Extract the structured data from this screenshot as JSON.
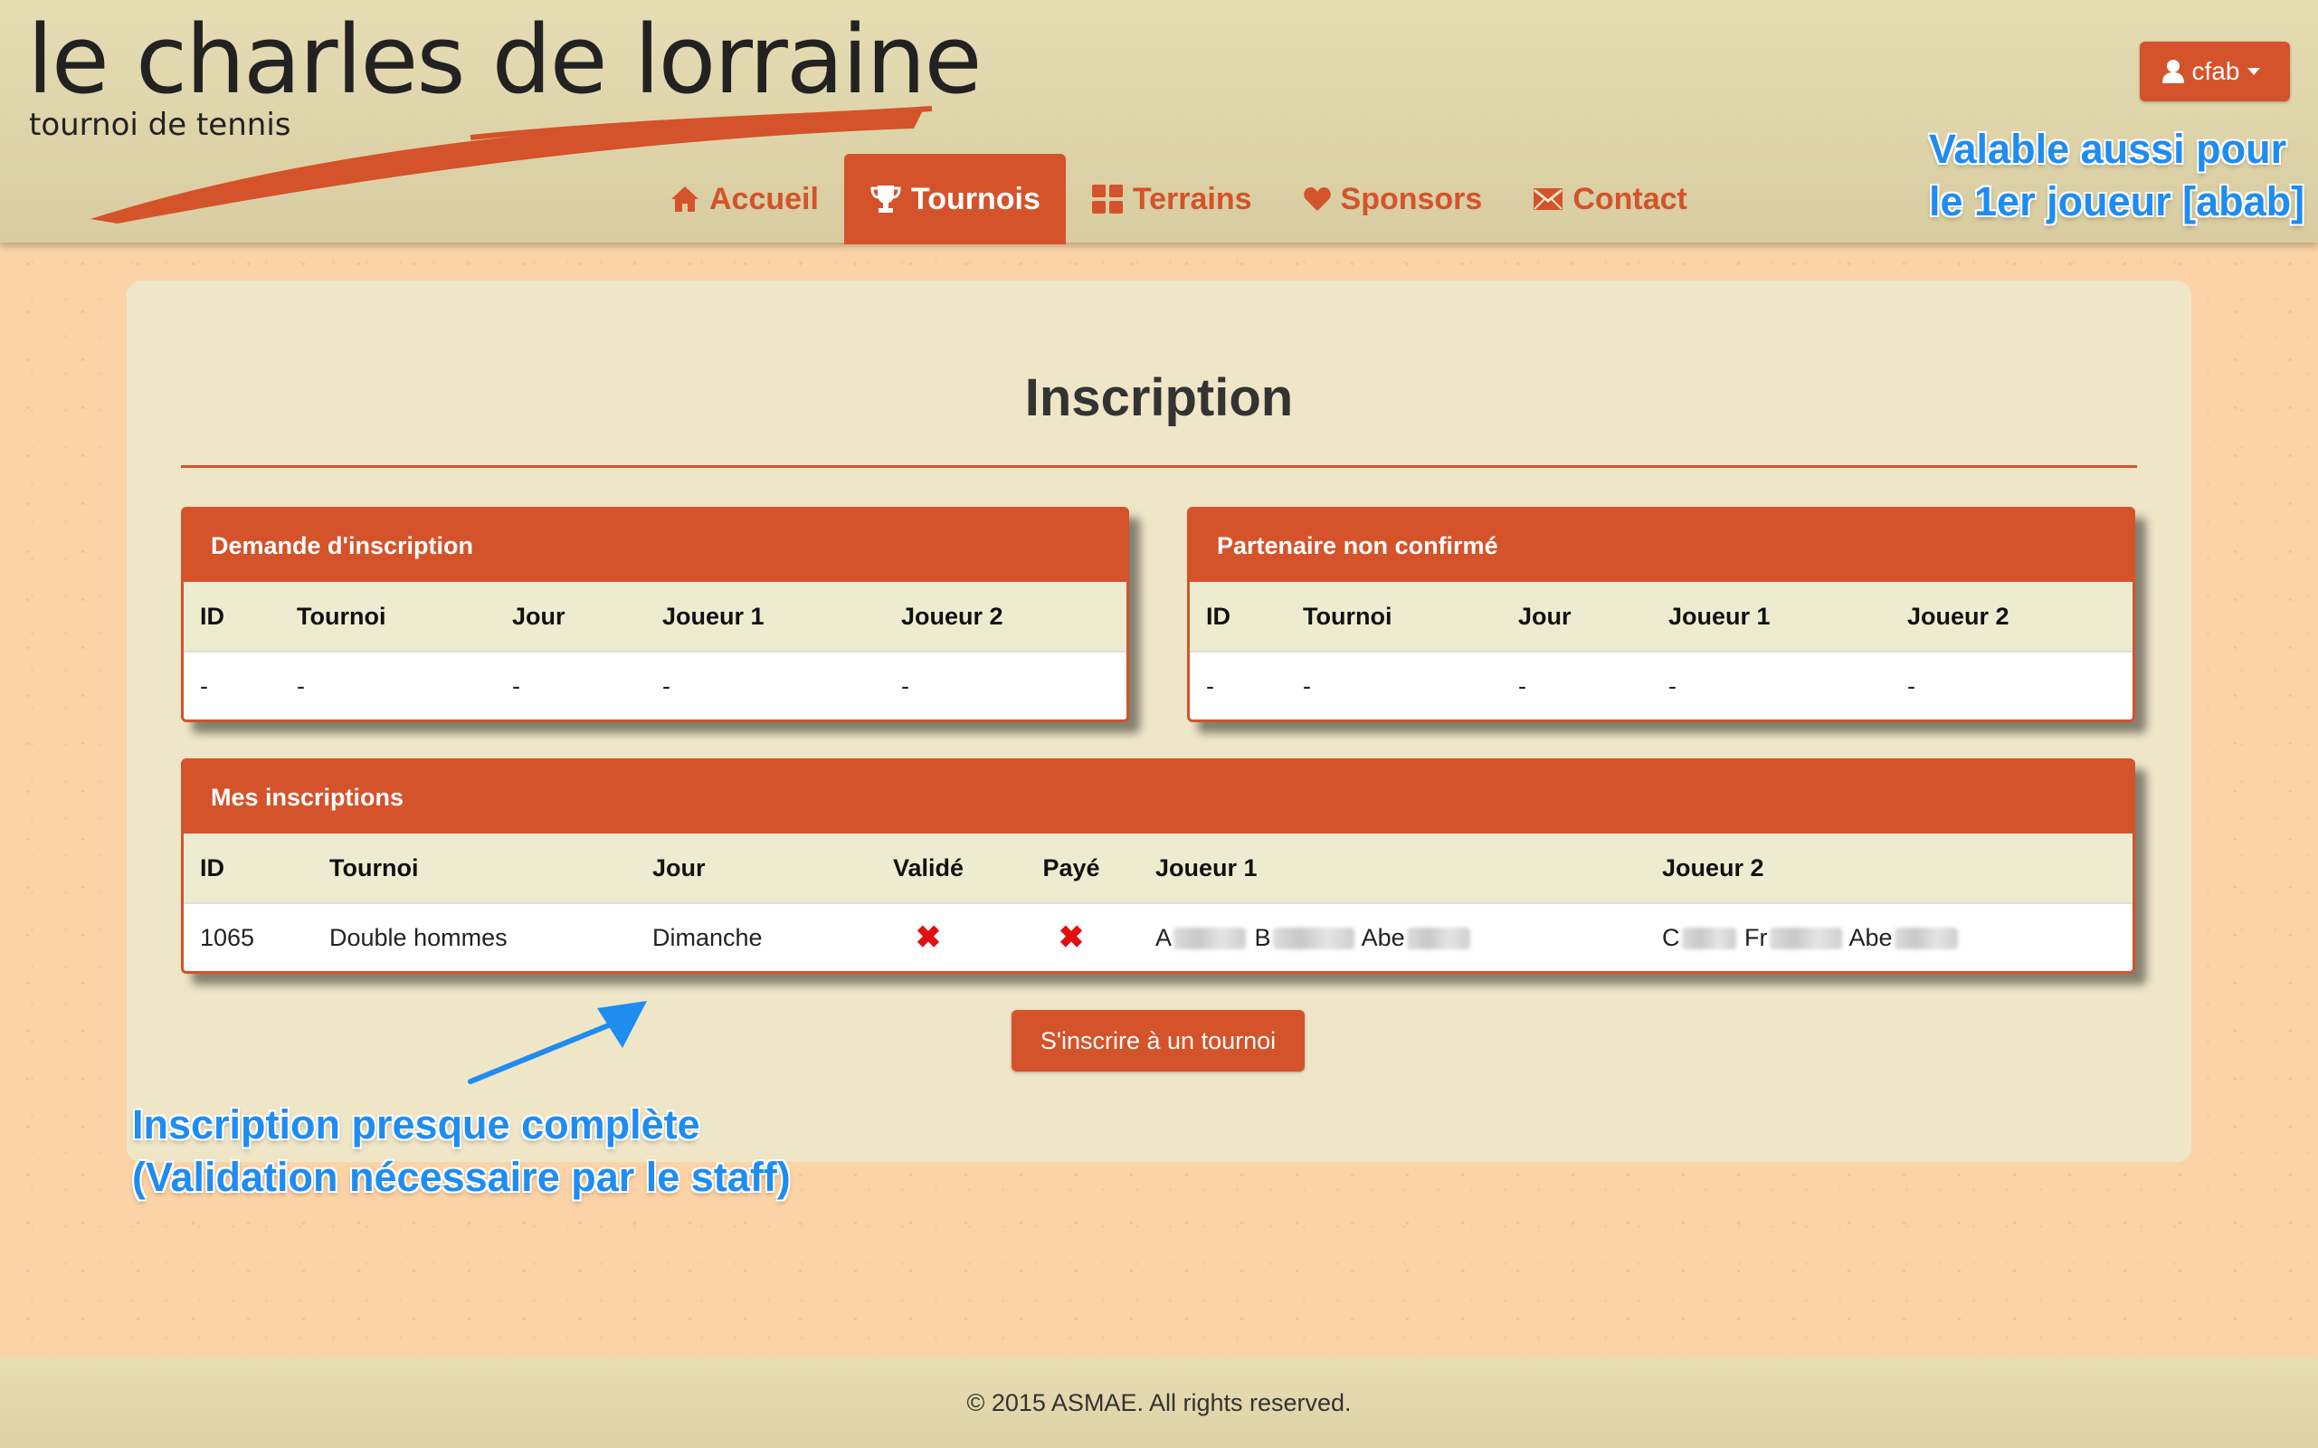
{
  "logo": {
    "title": "le charles de lorraine",
    "subtitle": "tournoi de tennis"
  },
  "nav": {
    "items": [
      {
        "label": "Accueil",
        "icon": "home-icon"
      },
      {
        "label": "Tournois",
        "icon": "trophy-icon",
        "active": true
      },
      {
        "label": "Terrains",
        "icon": "grid-icon"
      },
      {
        "label": "Sponsors",
        "icon": "heart-icon"
      },
      {
        "label": "Contact",
        "icon": "envelope-icon"
      }
    ]
  },
  "user_menu": {
    "label": "cfab",
    "icon": "user-icon"
  },
  "annotations": {
    "top_line1": "Valable aussi pour",
    "top_line2": "le 1er joueur [abab]",
    "bottom_line1": "Inscription presque complète",
    "bottom_line2": "(Validation nécessaire par le staff)"
  },
  "page": {
    "title": "Inscription"
  },
  "demande": {
    "title": "Demande d'inscription",
    "headers": [
      "ID",
      "Tournoi",
      "Jour",
      "Joueur 1",
      "Joueur 2"
    ],
    "row": [
      "-",
      "-",
      "-",
      "-",
      "-"
    ]
  },
  "partenaire": {
    "title": "Partenaire non confirmé",
    "headers": [
      "ID",
      "Tournoi",
      "Jour",
      "Joueur 1",
      "Joueur 2"
    ],
    "row": [
      "-",
      "-",
      "-",
      "-",
      "-"
    ]
  },
  "mes_inscriptions": {
    "title": "Mes inscriptions",
    "headers": [
      "ID",
      "Tournoi",
      "Jour",
      "Validé",
      "Payé",
      "Joueur 1",
      "Joueur 2"
    ],
    "row": {
      "id": "1065",
      "tournoi": "Double hommes",
      "jour": "Dimanche",
      "valide": "✖",
      "paye": "✖",
      "joueur1": [
        "A",
        "B",
        "Abe"
      ],
      "joueur2": [
        "C",
        "Fr",
        "Abe"
      ]
    }
  },
  "cta": {
    "label": "S'inscrire à un tournoi"
  },
  "footer": {
    "text": "© 2015 ASMAE. All rights reserved."
  },
  "colors": {
    "accent": "#d4532a",
    "annotation": "#1f8cf0",
    "background": "#fbd3a6"
  }
}
